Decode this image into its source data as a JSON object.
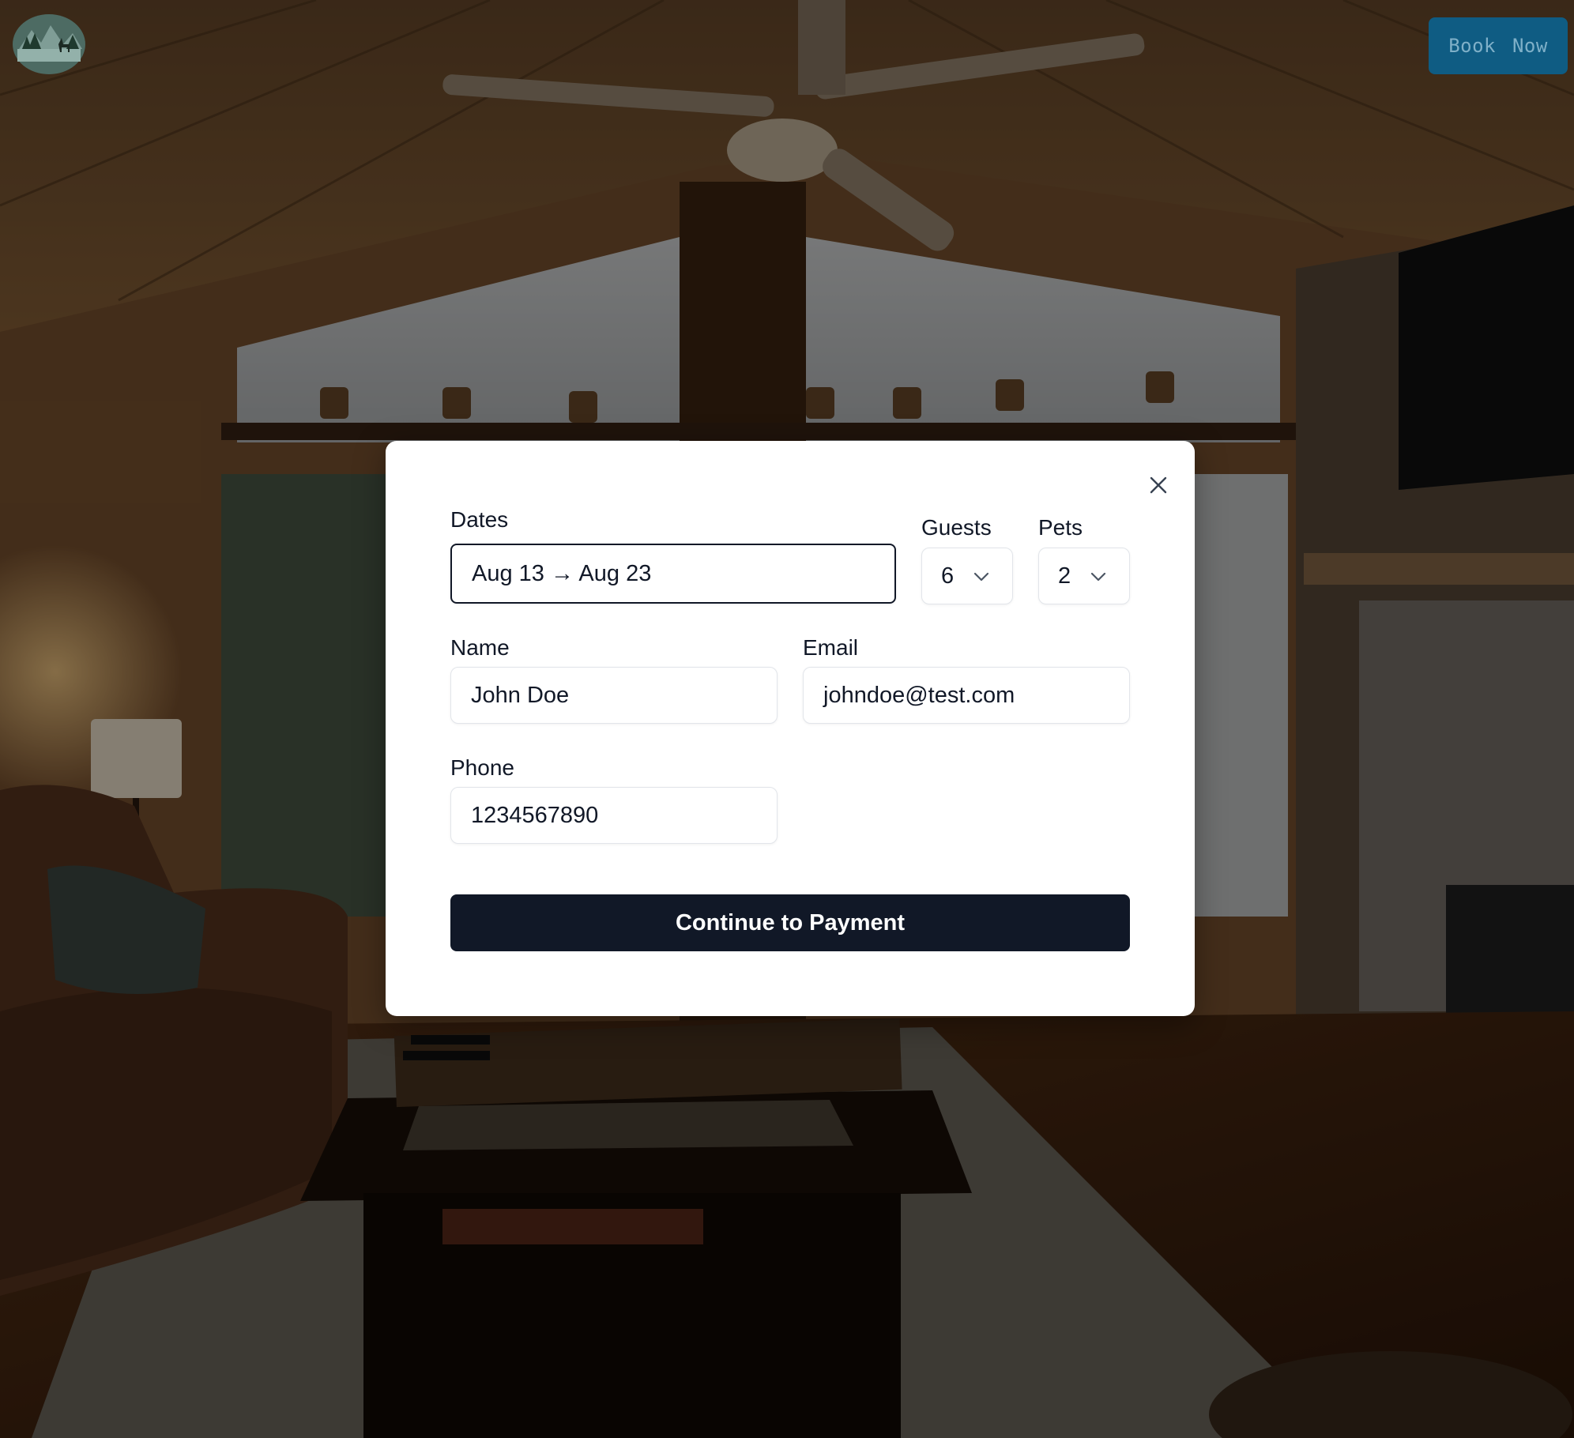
{
  "header": {
    "logo_icon": "cabin-lake-deer-logo-icon",
    "book_now_label": "Book Now",
    "book_now_color": "#0f5c83"
  },
  "modal": {
    "close_icon": "close-icon",
    "dates": {
      "label": "Dates",
      "value": "Aug 13 → Aug 23"
    },
    "guests": {
      "label": "Guests",
      "value": "6",
      "icon": "chevron-down-icon"
    },
    "pets": {
      "label": "Pets",
      "value": "2",
      "icon": "chevron-down-icon"
    },
    "name": {
      "label": "Name",
      "value": "John Doe"
    },
    "email": {
      "label": "Email",
      "value": "johndoe@test.com"
    },
    "phone": {
      "label": "Phone",
      "value": "1234567890"
    },
    "submit_label": "Continue to Payment",
    "submit_color": "#111827"
  }
}
